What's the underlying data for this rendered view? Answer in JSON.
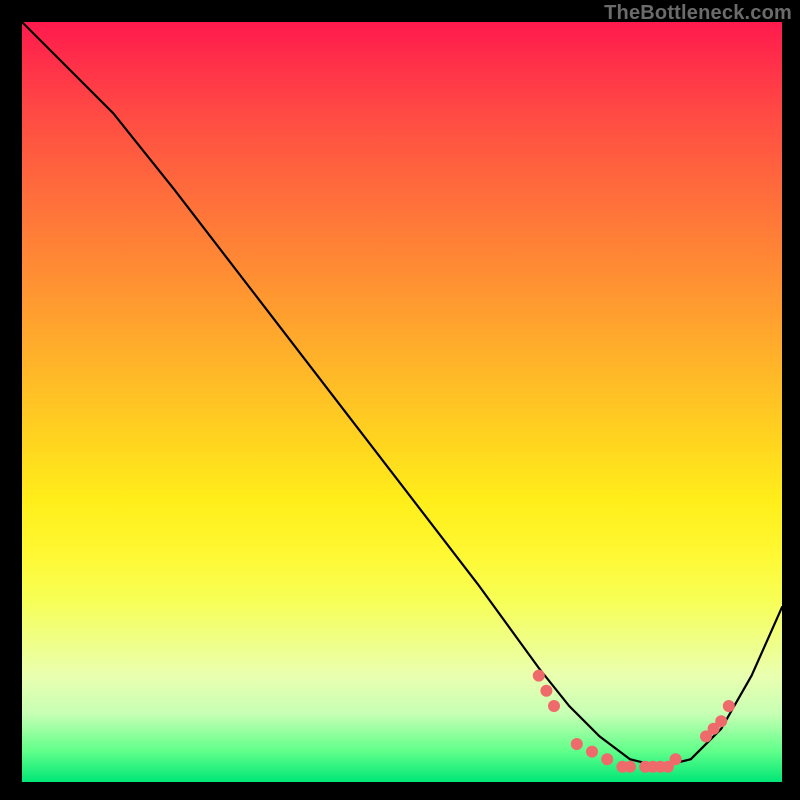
{
  "watermark": "TheBottleneck.com",
  "chart_data": {
    "type": "line",
    "title": "",
    "xlabel": "",
    "ylabel": "",
    "xlim": [
      0,
      100
    ],
    "ylim": [
      0,
      100
    ],
    "grid": false,
    "legend": false,
    "series": [
      {
        "name": "curve",
        "x": [
          0,
          5,
          12,
          20,
          30,
          40,
          50,
          60,
          68,
          72,
          76,
          80,
          84,
          88,
          92,
          96,
          100
        ],
        "y": [
          100,
          95,
          88,
          78,
          65,
          52,
          39,
          26,
          15,
          10,
          6,
          3,
          2,
          3,
          7,
          14,
          23
        ]
      }
    ],
    "markers": {
      "name": "highlight-points",
      "color": "#ef6a6a",
      "x": [
        68,
        69,
        70,
        73,
        75,
        77,
        79,
        80,
        82,
        83,
        84,
        85,
        86,
        90,
        91,
        92,
        93
      ],
      "y": [
        14,
        12,
        10,
        5,
        4,
        3,
        2,
        2,
        2,
        2,
        2,
        2,
        3,
        6,
        7,
        8,
        10
      ]
    }
  }
}
